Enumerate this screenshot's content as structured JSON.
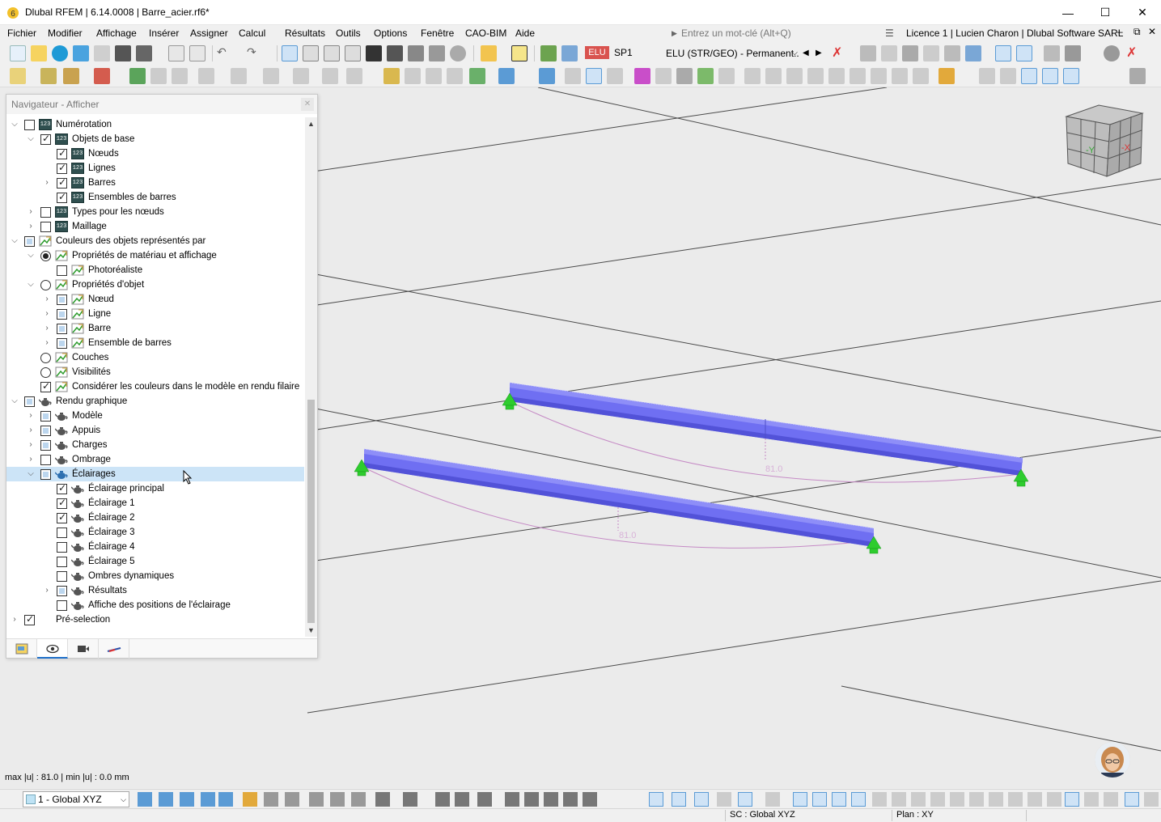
{
  "window": {
    "title": "Dlubal RFEM | 6.14.0008 | Barre_acier.rf6*",
    "minimize": "—",
    "maximize": "☐",
    "close": "✕"
  },
  "menu": {
    "items": [
      "Fichier",
      "Modifier",
      "Affichage",
      "Insérer",
      "Assigner",
      "Calcul",
      "Résultats",
      "Outils",
      "Options",
      "Fenêtre",
      "CAO-BIM",
      "Aide"
    ],
    "search_placeholder": "Entrez un mot-clé (Alt+Q)",
    "license": "Licence 1 | Lucien Charon | Dlubal Software SARL",
    "mdi_min": "–",
    "mdi_restore": "⧉",
    "mdi_close": "✕"
  },
  "toolbar": {
    "load_badge": "ELU",
    "load_case": "SP1",
    "combo_value": "ELU (STR/GEO) - Permanent..."
  },
  "navigator": {
    "title": "Navigateur - Afficher",
    "close": "✕",
    "items": [
      {
        "label": "Numérotation"
      },
      {
        "label": "Objets de base"
      },
      {
        "label": "Nœuds"
      },
      {
        "label": "Lignes"
      },
      {
        "label": "Barres"
      },
      {
        "label": "Ensembles de barres"
      },
      {
        "label": "Types pour les nœuds"
      },
      {
        "label": "Maillage"
      },
      {
        "label": "Couleurs des objets représentés par"
      },
      {
        "label": "Propriétés de matériau et affichage"
      },
      {
        "label": "Photoréaliste"
      },
      {
        "label": "Propriétés d'objet"
      },
      {
        "label": "Nœud"
      },
      {
        "label": "Ligne"
      },
      {
        "label": "Barre"
      },
      {
        "label": "Ensemble de barres"
      },
      {
        "label": "Couches"
      },
      {
        "label": "Visibilités"
      },
      {
        "label": "Considérer les couleurs dans le modèle en rendu filaire"
      },
      {
        "label": "Rendu graphique"
      },
      {
        "label": "Modèle"
      },
      {
        "label": "Appuis"
      },
      {
        "label": "Charges"
      },
      {
        "label": "Ombrage"
      },
      {
        "label": "Éclairages"
      },
      {
        "label": "Éclairage principal"
      },
      {
        "label": "Éclairage 1"
      },
      {
        "label": "Éclairage 2"
      },
      {
        "label": "Éclairage 3"
      },
      {
        "label": "Éclairage 4"
      },
      {
        "label": "Éclairage 5"
      },
      {
        "label": "Ombres dynamiques"
      },
      {
        "label": "Résultats"
      },
      {
        "label": "Affiche des positions de l'éclairage"
      },
      {
        "label": "Pré-selection"
      }
    ]
  },
  "viewport": {
    "cube_y": "-Y",
    "cube_x": "-X",
    "dim1": "81.0",
    "dim2": "81.0",
    "max_info": "max |u| : 81.0 | min |u| : 0.0 mm"
  },
  "bottom": {
    "coord_system": "1 - Global XYZ"
  },
  "status": {
    "sc": "SC : Global XYZ",
    "plan": "Plan : XY"
  },
  "colors": {
    "beam": "#6f6ff2",
    "support": "#2ecc2e",
    "selection": "#cce4f7",
    "arrow": "#e8413a"
  }
}
